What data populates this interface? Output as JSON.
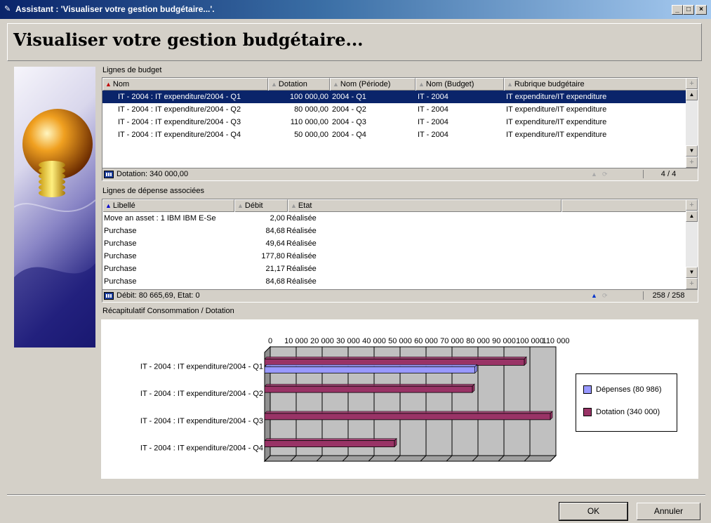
{
  "window": {
    "title": "Assistant : 'Visualiser votre gestion budgétaire...'.",
    "min": "_",
    "max": "□",
    "close": "×"
  },
  "header": {
    "title": "Visualiser votre gestion budgétaire..."
  },
  "budget": {
    "label": "Lignes de budget",
    "columns": [
      "Nom",
      "Dotation",
      "Nom (Période)",
      "Nom (Budget)",
      "Rubrique budgétaire"
    ],
    "rows": [
      {
        "nom": "IT - 2004 : IT expenditure/2004 - Q1",
        "dotation": "100 000,00",
        "periode": "2004 - Q1",
        "budget": "IT - 2004",
        "rubrique": "IT expenditure/IT expenditure",
        "selected": true
      },
      {
        "nom": "IT - 2004 : IT expenditure/2004 - Q2",
        "dotation": "80 000,00",
        "periode": "2004 - Q2",
        "budget": "IT - 2004",
        "rubrique": "IT expenditure/IT expenditure",
        "selected": false
      },
      {
        "nom": "IT - 2004 : IT expenditure/2004 - Q3",
        "dotation": "110 000,00",
        "periode": "2004 - Q3",
        "budget": "IT - 2004",
        "rubrique": "IT expenditure/IT expenditure",
        "selected": false
      },
      {
        "nom": "IT - 2004 : IT expenditure/2004 - Q4",
        "dotation": "50 000,00",
        "periode": "2004 - Q4",
        "budget": "IT - 2004",
        "rubrique": "IT expenditure/IT expenditure",
        "selected": false
      }
    ],
    "footer": "Dotation: 340 000,00",
    "count": "4 / 4"
  },
  "expenses": {
    "label": "Lignes de dépense associées",
    "columns": [
      "Libellé",
      "Débit",
      "Etat"
    ],
    "rows": [
      {
        "libelle": "Move an asset : 1 IBM IBM E-Se",
        "debit": "2,00",
        "etat": "Réalisée"
      },
      {
        "libelle": "Purchase",
        "debit": "84,68",
        "etat": "Réalisée"
      },
      {
        "libelle": "Purchase",
        "debit": "49,64",
        "etat": "Réalisée"
      },
      {
        "libelle": "Purchase",
        "debit": "177,80",
        "etat": "Réalisée"
      },
      {
        "libelle": "Purchase",
        "debit": "21,17",
        "etat": "Réalisée"
      },
      {
        "libelle": "Purchase",
        "debit": "84,68",
        "etat": "Réalisée"
      }
    ],
    "footer": "Débit: 80 665,69, Etat: 0",
    "count": "258 / 258"
  },
  "chart_label": "Récapitulatif Consommation / Dotation",
  "chart_data": {
    "type": "bar",
    "orientation": "horizontal",
    "categories": [
      "IT - 2004 : IT expenditure/2004 - Q1",
      "IT - 2004 : IT expenditure/2004 - Q2",
      "IT - 2004 : IT expenditure/2004 - Q3",
      "IT - 2004 : IT expenditure/2004 - Q4"
    ],
    "series": [
      {
        "name": "Dépenses (80 986)",
        "values": [
          80986,
          0,
          0,
          0
        ],
        "color": "#9999ff"
      },
      {
        "name": "Dotation (340 000)",
        "values": [
          100000,
          80000,
          110000,
          50000
        ],
        "color": "#993366"
      }
    ],
    "xticks": [
      "0",
      "10 000",
      "20 000",
      "30 000",
      "40 000",
      "50 000",
      "60 000",
      "70 000",
      "80 000",
      "90 000",
      "100 000",
      "110 000"
    ],
    "xlim": [
      0,
      110000
    ],
    "grid": true,
    "legend": "right"
  },
  "buttons": {
    "ok": "OK",
    "cancel": "Annuler"
  },
  "colors": {
    "selection": "#0a246a",
    "spend": "#9999ff",
    "allocation": "#993366"
  }
}
